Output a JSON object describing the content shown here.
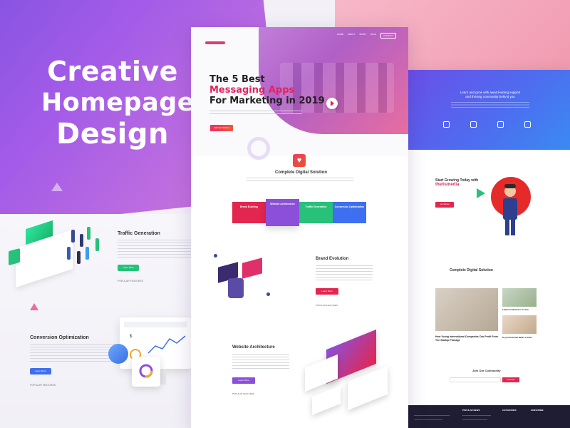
{
  "hero": {
    "line1": "Creative",
    "line2": "Homepage",
    "line3": "Design"
  },
  "colors": {
    "purple": "#9a5ce6",
    "pink": "#e0245e",
    "blue": "#3e6ff0",
    "green": "#27c17a"
  },
  "center": {
    "title_line1": "The 5 Best",
    "title_line2": "Messaging Apps",
    "title_line3": "For Marketing in 2019",
    "cta": "GET IN TOUCH",
    "section_title": "Complete Digital Solution",
    "tiles": [
      {
        "title": "Brand Building"
      },
      {
        "title": "Website Architecture"
      },
      {
        "title": "Traffic Generation"
      },
      {
        "title": "Conversion Optimization"
      }
    ],
    "brand_title": "Brand Evolution",
    "brand_btn": "Learn More",
    "brand_label": "POPULAR FEATURES",
    "web_title": "Website Architecture",
    "web_btn": "Learn More",
    "web_label": "POPULAR FEATURES"
  },
  "left": {
    "traffic_title": "Traffic Generation",
    "traffic_btn": "Learn More",
    "traffic_label": "POPULAR FEATURES",
    "conversion_title": "Conversion Optimization",
    "conversion_btn": "Learn More",
    "conversion_label": "POPULAR FEATURES"
  },
  "right": {
    "hero_title_1": "Learn and grow with award-wining support",
    "hero_title_2": "and thriving community behind you",
    "start_line": "Start Growing Today with",
    "brand": "thetismedia",
    "start_btn": "Get Started",
    "section_title": "Complete Digital Solution",
    "photo1_caption": "How Young International Companies Can Profit From The Startup Package",
    "photo2_caption": "5 Ideas For Business You Can",
    "photo3_caption": "Do you Know that Nature is Great",
    "newsletter_title": "Join Our Community",
    "newsletter_btn": "Subscribe",
    "footer_col1": "POPULAR NEWS",
    "footer_col2": "CATEGORIES",
    "footer_col3": "SUBSCRIBE"
  }
}
